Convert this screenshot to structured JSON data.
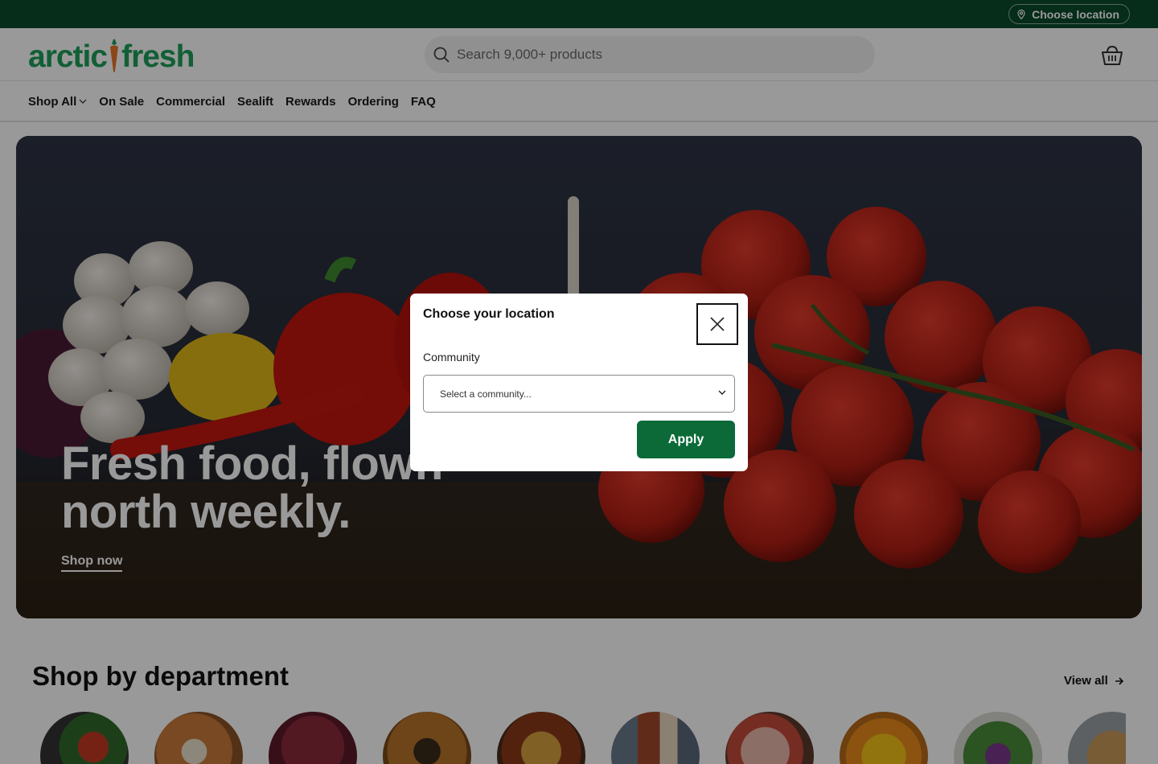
{
  "topbar": {
    "location_label": "Choose location"
  },
  "header": {
    "logo_left": "arctic",
    "logo_right": "fresh",
    "search_placeholder": "Search 9,000+ products"
  },
  "nav": {
    "items": [
      "Shop All",
      "On Sale",
      "Commercial",
      "Sealift",
      "Rewards",
      "Ordering",
      "FAQ"
    ]
  },
  "hero": {
    "title_line1": "Fresh food, flown",
    "title_line2": "north weekly.",
    "cta": "Shop now"
  },
  "departments": {
    "title": "Shop by department",
    "view_all": "View all"
  },
  "modal": {
    "title": "Choose your location",
    "field_label": "Community",
    "select_placeholder": "Select a community...",
    "apply": "Apply"
  },
  "colors": {
    "brand_dark": "#0b4a2c",
    "brand_green": "#1f9e5a",
    "apply_green": "#0b6a38"
  }
}
